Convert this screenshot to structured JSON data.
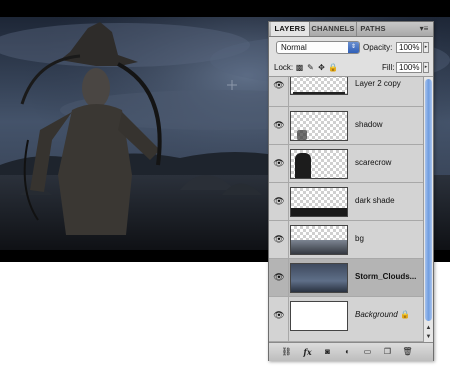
{
  "panel": {
    "tabs": [
      "LAYERS",
      "CHANNELS",
      "PATHS"
    ],
    "menu_icon": "panel-menu-icon",
    "blend_mode": "Normal",
    "opacity_label": "Opacity:",
    "opacity_value": "100%",
    "lock_label": "Lock:",
    "fill_label": "Fill:",
    "fill_value": "100%"
  },
  "layers": [
    {
      "name": "Layer 2 copy",
      "style": "normal"
    },
    {
      "name": "shadow",
      "style": "normal"
    },
    {
      "name": "scarecrow",
      "style": "normal"
    },
    {
      "name": "dark shade",
      "style": "normal"
    },
    {
      "name": "bg",
      "style": "normal"
    },
    {
      "name": "Storm_Clouds...",
      "style": "bold",
      "selected": true
    },
    {
      "name": "Background",
      "style": "italic",
      "locked": true
    }
  ],
  "lock_icons": [
    "lock-transparent-icon",
    "lock-paint-icon",
    "lock-move-icon",
    "lock-all-icon"
  ],
  "bottom_icons": [
    "link-layers-icon",
    "fx-icon",
    "add-mask-icon",
    "adjustment-layer-icon",
    "new-group-icon",
    "new-layer-icon",
    "trash-icon"
  ],
  "colors": {
    "selection": "#b4b4b4",
    "scrollbar": "#6f9de0"
  }
}
